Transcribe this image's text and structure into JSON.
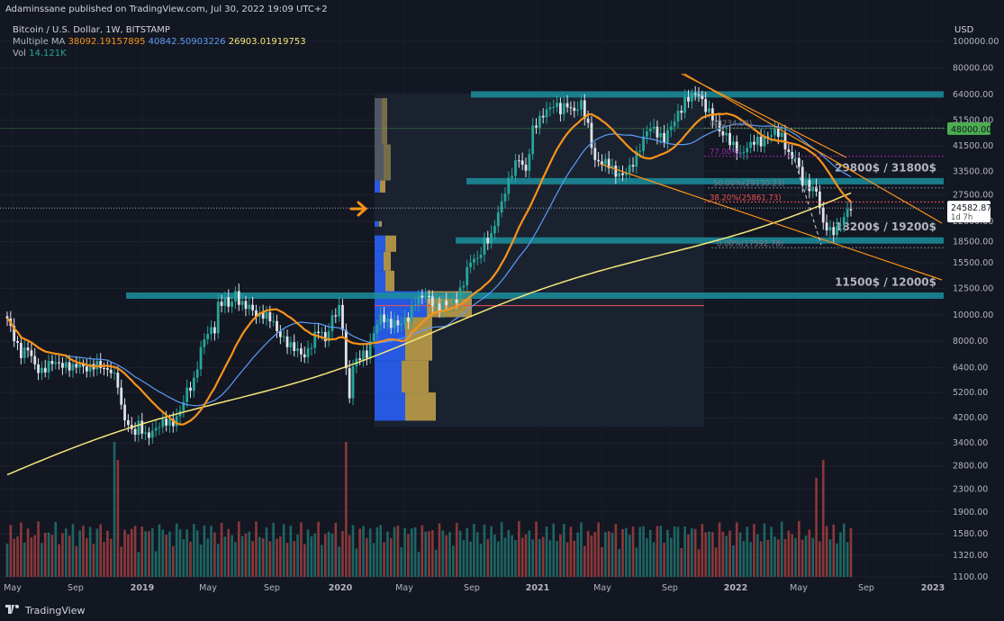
{
  "header": {
    "publisher": "Adaminssane published on TradingView.com, Jul 30, 2022 19:09 UTC+2",
    "symbol": "Bitcoin / U.S. Dollar, 1W, BITSTAMP",
    "ma_label": "Multiple MA",
    "ma_values": [
      "38092.19157895",
      "40842.50903226",
      "26903.01919753"
    ],
    "vol_label": "Vol",
    "vol_value": "14.121K",
    "currency": "USD"
  },
  "colors": {
    "background": "#131722",
    "up": "#26a69a",
    "down": "#ef5350",
    "ma_orange": "#f7931a",
    "ma_blue": "#5b9cf6",
    "ma_yellow": "#f5e67a",
    "zone": "#1b8e9c",
    "trend": "#f7931a"
  },
  "footer": {
    "brand": "TradingView"
  },
  "chart_data": {
    "type": "candlestick",
    "scale": "log",
    "ylim": [
      1100,
      110000
    ],
    "y_ticks": [
      "100000.00",
      "80000.00",
      "64000.00",
      "51500.00",
      "41500.00",
      "33500.00",
      "27500.00",
      "22000.00",
      "18500.00",
      "15500.00",
      "12500.00",
      "10000.00",
      "8000.00",
      "6400.00",
      "5200.00",
      "4200.00",
      "3400.00",
      "2800.00",
      "2300.00",
      "1900.00",
      "1580.00",
      "1320.00",
      "1100.00"
    ],
    "x_ticks": [
      "May",
      "Sep",
      "2019",
      "May",
      "Sep",
      "2020",
      "May",
      "Sep",
      "2021",
      "May",
      "Sep",
      "2022",
      "May",
      "Sep",
      "2023"
    ],
    "price_labels": {
      "level_48000": "48000.00",
      "current": "24582.87",
      "countdown": "1d 7h"
    },
    "zones": [
      {
        "label": "",
        "price": 64000
      },
      {
        "label": "29800$ / 31800$",
        "price": 30800
      },
      {
        "label": "18200$ / 19200$",
        "price": 18700
      },
      {
        "label": "11500$ / 12000$",
        "price": 11750
      }
    ],
    "fib_levels": [
      {
        "label": "(48234.00)",
        "price": 48234
      },
      {
        "label": "77.00%",
        "price": 38000
      },
      {
        "label": "50.00%(29130.23)",
        "price": 29130
      },
      {
        "label": "38.20%(25861.73)",
        "price": 25861
      },
      {
        "label": "0.00%(17592.78)",
        "price": 17592
      }
    ],
    "weekly_closes": [
      [
        0,
        9500
      ],
      [
        2,
        8300
      ],
      [
        4,
        7300
      ],
      [
        6,
        7400
      ],
      [
        8,
        6500
      ],
      [
        10,
        6300
      ],
      [
        13,
        6600
      ],
      [
        16,
        6700
      ],
      [
        19,
        6300
      ],
      [
        21,
        6600
      ],
      [
        24,
        6400
      ],
      [
        27,
        6500
      ],
      [
        30,
        6300
      ],
      [
        32,
        5500
      ],
      [
        33,
        4500
      ],
      [
        35,
        4000
      ],
      [
        37,
        3700
      ],
      [
        38,
        3900
      ],
      [
        40,
        3600
      ],
      [
        42,
        3800
      ],
      [
        44,
        3900
      ],
      [
        46,
        4050
      ],
      [
        48,
        4100
      ],
      [
        50,
        4400
      ],
      [
        52,
        5200
      ],
      [
        54,
        5800
      ],
      [
        56,
        7500
      ],
      [
        58,
        8500
      ],
      [
        60,
        9000
      ],
      [
        61,
        11000
      ],
      [
        63,
        11300
      ],
      [
        64,
        10500
      ],
      [
        66,
        12000
      ],
      [
        68,
        11000
      ],
      [
        70,
        10500
      ],
      [
        72,
        10000
      ],
      [
        74,
        10200
      ],
      [
        76,
        9600
      ],
      [
        78,
        8700
      ],
      [
        80,
        8300
      ],
      [
        82,
        7600
      ],
      [
        84,
        7300
      ],
      [
        86,
        7200
      ],
      [
        88,
        7800
      ],
      [
        90,
        8700
      ],
      [
        92,
        8200
      ],
      [
        94,
        9800
      ],
      [
        96,
        10300
      ],
      [
        97,
        9000
      ],
      [
        98,
        6300
      ],
      [
        99,
        5100
      ],
      [
        100,
        6600
      ],
      [
        102,
        6900
      ],
      [
        104,
        7200
      ],
      [
        106,
        8800
      ],
      [
        108,
        9700
      ],
      [
        110,
        9300
      ],
      [
        112,
        9500
      ],
      [
        114,
        9200
      ],
      [
        116,
        9600
      ],
      [
        118,
        11500
      ],
      [
        120,
        11700
      ],
      [
        122,
        11300
      ],
      [
        124,
        10800
      ],
      [
        126,
        11000
      ],
      [
        128,
        10700
      ],
      [
        130,
        11500
      ],
      [
        132,
        13400
      ],
      [
        134,
        15500
      ],
      [
        136,
        16000
      ],
      [
        138,
        18800
      ],
      [
        140,
        19000
      ],
      [
        142,
        23500
      ],
      [
        144,
        29000
      ],
      [
        146,
        33000
      ],
      [
        148,
        37000
      ],
      [
        150,
        34000
      ],
      [
        152,
        47500
      ],
      [
        154,
        51000
      ],
      [
        156,
        57000
      ],
      [
        158,
        59000
      ],
      [
        160,
        55000
      ],
      [
        162,
        59500
      ],
      [
        164,
        56000
      ],
      [
        166,
        58000
      ],
      [
        168,
        49000
      ],
      [
        170,
        37000
      ],
      [
        172,
        35500
      ],
      [
        174,
        35500
      ],
      [
        176,
        33500
      ],
      [
        178,
        32000
      ],
      [
        180,
        34000
      ],
      [
        182,
        39000
      ],
      [
        184,
        44000
      ],
      [
        186,
        48000
      ],
      [
        188,
        47000
      ],
      [
        190,
        44000
      ],
      [
        192,
        48000
      ],
      [
        194,
        55000
      ],
      [
        196,
        61000
      ],
      [
        198,
        62000
      ],
      [
        200,
        64500
      ],
      [
        202,
        58000
      ],
      [
        204,
        52000
      ],
      [
        206,
        47000
      ],
      [
        208,
        46000
      ],
      [
        210,
        41000
      ],
      [
        212,
        38000
      ],
      [
        214,
        42000
      ],
      [
        216,
        43000
      ],
      [
        218,
        42000
      ],
      [
        220,
        46000
      ],
      [
        222,
        47000
      ],
      [
        224,
        44000
      ],
      [
        226,
        39000
      ],
      [
        228,
        38000
      ],
      [
        230,
        30000
      ],
      [
        232,
        29500
      ],
      [
        234,
        29000
      ],
      [
        236,
        21000
      ],
      [
        238,
        20200
      ],
      [
        240,
        21000
      ],
      [
        242,
        22500
      ],
      [
        244,
        24582
      ]
    ]
  }
}
